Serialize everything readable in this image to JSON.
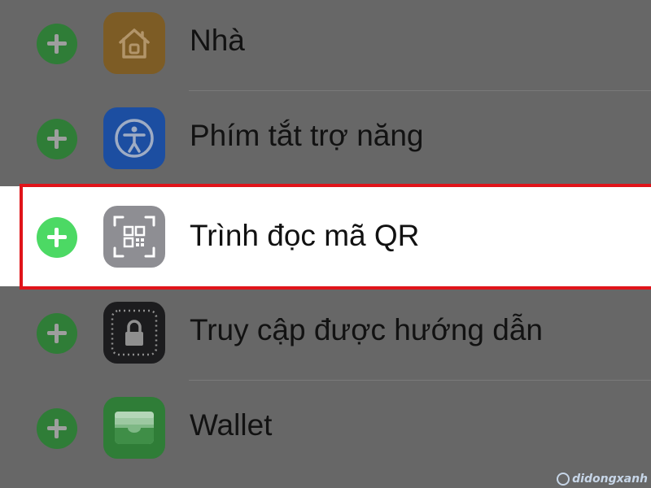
{
  "items": [
    {
      "label": "Nhà",
      "icon": "home-icon",
      "icon_color": "#7d5c25"
    },
    {
      "label": "Phím tắt trợ năng",
      "icon": "accessibility-icon",
      "icon_color": "#1c4ea1"
    },
    {
      "label": "Trình đọc mã QR",
      "icon": "qr-code-icon",
      "icon_color": "#8e8e93",
      "highlighted": true
    },
    {
      "label": "Truy cập được hướng dẫn",
      "icon": "lock-icon",
      "icon_color": "#1c1c1e"
    },
    {
      "label": "Wallet",
      "icon": "wallet-icon",
      "icon_color": "#2f7d37"
    }
  ],
  "add_button_icon": "plus-circle-icon",
  "add_button_color": "#4cd964",
  "highlight_color": "#e0141a",
  "watermark": "didongxanh"
}
